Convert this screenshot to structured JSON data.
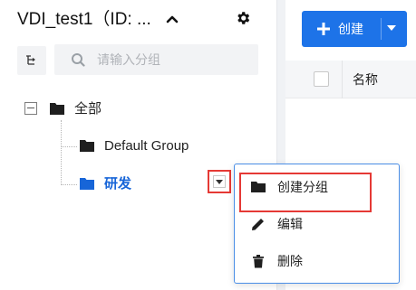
{
  "panel": {
    "title": "VDI_test1（ID: ...",
    "search_placeholder": "请输入分组"
  },
  "tree": {
    "root_label": "全部",
    "children": [
      {
        "label": "Default Group",
        "selected": false
      },
      {
        "label": "研发",
        "selected": true
      }
    ]
  },
  "toolbar": {
    "create_label": "创建"
  },
  "table": {
    "columns": [
      "名称"
    ]
  },
  "context_menu": {
    "items": [
      {
        "label": "创建分组",
        "icon": "folder-icon",
        "highlighted": true
      },
      {
        "label": "编辑",
        "icon": "pencil-icon"
      },
      {
        "label": "删除",
        "icon": "trash-icon"
      }
    ]
  },
  "colors": {
    "accent": "#1d73e8",
    "selected_text": "#1765d8",
    "highlight_box": "#e53935",
    "menu_border": "#4a8ee6"
  }
}
